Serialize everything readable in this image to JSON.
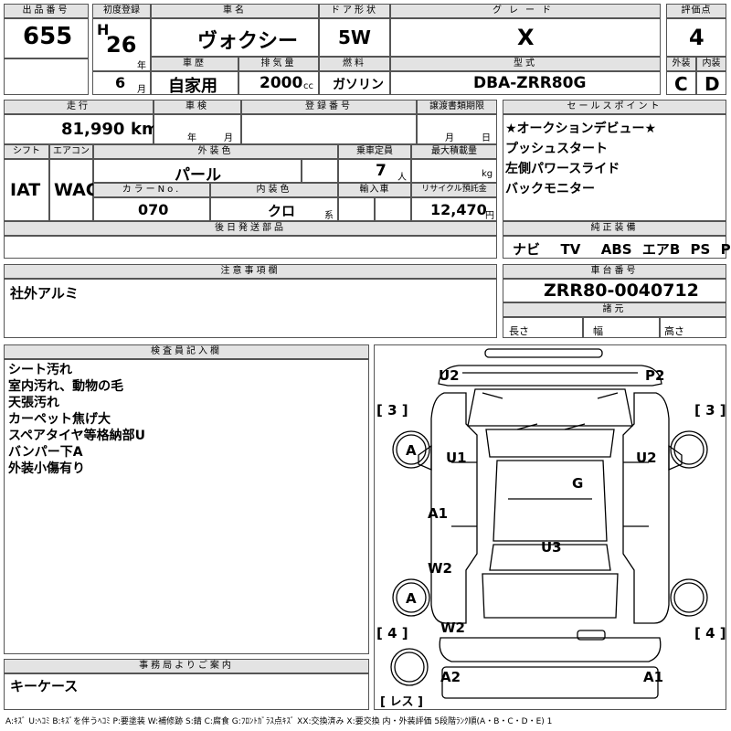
{
  "headers": {
    "lot_no": "出品番号",
    "first_reg": "初度登録",
    "car_name": "車名",
    "door": "ドア形状",
    "grade": "グレード",
    "score": "評価点",
    "history": "車歴",
    "displacement": "排気量",
    "fuel": "燃料",
    "model": "型式",
    "exterior": "外装",
    "interior": "内装",
    "mileage": "走行",
    "inspection": "車検",
    "reg_no": "登録番号",
    "transfer": "譲渡書類期限",
    "sales_point": "セールスポイント",
    "shift": "シフト",
    "aircon": "エアコン",
    "ext_color": "外装色",
    "capacity": "乗車定員",
    "max_load": "最大積載量",
    "color_no": "カラーNo.",
    "int_color": "内装色",
    "import": "輸入車",
    "recycle": "リサイクル預託金",
    "later_parts": "後日発送部品",
    "genuine": "純正装備",
    "notes": "注意事項欄",
    "chassis": "車台番号",
    "specs": "諸元",
    "inspector": "検査員記入欄",
    "office": "事務局よりご案内"
  },
  "vehicle": {
    "lot_no": "655",
    "era": "H",
    "year": "26",
    "year_unit": "年",
    "month": "6",
    "month_unit": "月",
    "name": "ヴォクシー",
    "door": "5W",
    "grade": "X",
    "score": "4",
    "history": "自家用",
    "displacement": "2000",
    "displacement_unit": "cc",
    "fuel": "ガソリン",
    "model": "DBA-ZRR80G",
    "ext_grade": "C",
    "int_grade": "D",
    "mileage": "81,990",
    "mileage_unit": "km",
    "insp_year_unit": "年",
    "insp_month_unit": "月",
    "transfer_month_unit": "月",
    "transfer_day_unit": "日",
    "shift": "IAT",
    "aircon": "WAC",
    "color": "パール",
    "capacity": "7",
    "capacity_unit": "人",
    "load_unit": "kg",
    "color_no": "070",
    "int_color": "クロ",
    "int_color_unit": "系",
    "recycle": "12,470",
    "recycle_unit": "円",
    "chassis": "ZRR80-0040712",
    "spec_length": "長さ",
    "spec_width": "幅",
    "spec_height": "高さ"
  },
  "sales_points": [
    "★オークションデビュー★",
    "プッシュスタート",
    "左側パワースライド",
    "バックモニター"
  ],
  "equipment": [
    "ナビ",
    "TV",
    "ABS",
    "エアB",
    "PS",
    "PW"
  ],
  "notes_text": "社外アルミ",
  "inspector_notes": [
    "シート汚れ",
    "室内汚れ、動物の毛",
    "天張汚れ",
    "カーペット焦げ大",
    "スペアタイヤ等格納部U",
    "バンパー下A",
    "外装小傷有り"
  ],
  "office_note": "キーケース",
  "diagram": {
    "labels": {
      "u2_left": "U2",
      "p2": "P2",
      "u1": "U1",
      "u2_right": "U2",
      "g": "G",
      "a1_left": "A1",
      "u3": "U3",
      "w2_upper": "W2",
      "w2_lower": "W2",
      "a2": "A2",
      "a1_bottom": "A1",
      "tire_a_front": "A",
      "tire_a_rear": "A",
      "bracket_3_left": "[ 3 ]",
      "bracket_3_right": "[ 3 ]",
      "bracket_4_left": "[ 4 ]",
      "bracket_4_right": "[ 4 ]",
      "spare": "[ レス ]"
    }
  },
  "legend": "A:ｷｽﾞ U:ﾍｺﾐ B:ｷｽﾞを伴うﾍｺﾐ P:要塗装 W:補修跡 S:錆 C:腐食 G:ﾌﾛﾝﾄｶﾞﾗｽ点ｷｽﾞ XX:交換済み X:要交換 内・外装評価 5段階ﾗﾝｸ順(A・B・C・D・E) 1"
}
